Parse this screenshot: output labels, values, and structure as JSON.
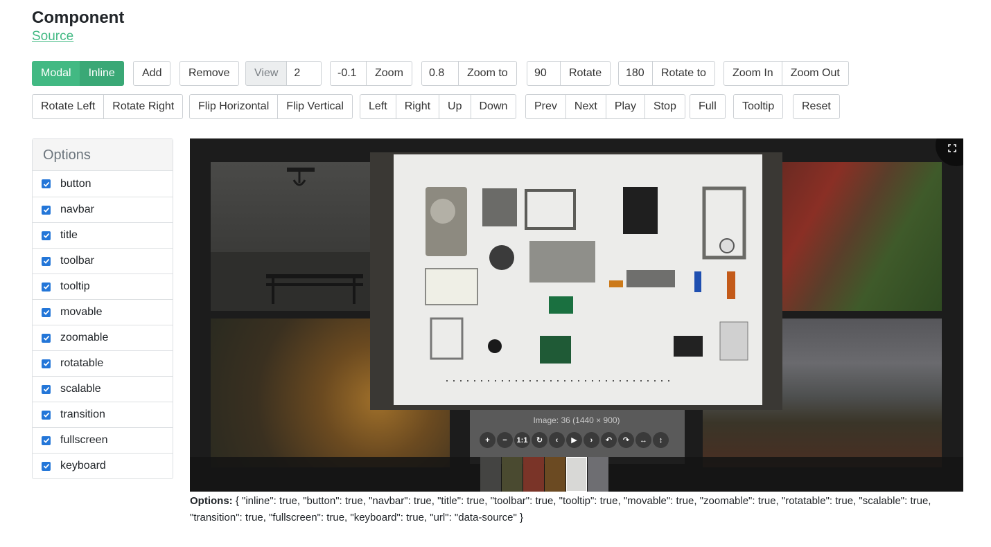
{
  "header": {
    "title": "Component",
    "source_link": "Source"
  },
  "toolbar_row1": {
    "modal": "Modal",
    "inline": "Inline",
    "add": "Add",
    "remove": "Remove",
    "view_label": "View",
    "view_value": "2",
    "zoom_value": "-0.1",
    "zoom": "Zoom",
    "zoom_to_value": "0.8",
    "zoom_to": "Zoom to",
    "rotate_value": "90",
    "rotate": "Rotate",
    "rotate_to_value": "180",
    "rotate_to": "Rotate to",
    "zoom_in": "Zoom In",
    "zoom_out": "Zoom Out"
  },
  "toolbar_row2": {
    "rotate_left": "Rotate Left",
    "rotate_right": "Rotate Right",
    "flip_horizontal": "Flip Horizontal",
    "flip_vertical": "Flip Vertical",
    "left": "Left",
    "right": "Right",
    "up": "Up",
    "down": "Down",
    "prev": "Prev",
    "next": "Next",
    "play": "Play",
    "stop": "Stop",
    "full": "Full",
    "tooltip": "Tooltip",
    "reset": "Reset"
  },
  "options_panel": {
    "heading": "Options",
    "items": [
      {
        "label": "button",
        "checked": true
      },
      {
        "label": "navbar",
        "checked": true
      },
      {
        "label": "title",
        "checked": true
      },
      {
        "label": "toolbar",
        "checked": true
      },
      {
        "label": "tooltip",
        "checked": true
      },
      {
        "label": "movable",
        "checked": true
      },
      {
        "label": "zoomable",
        "checked": true
      },
      {
        "label": "rotatable",
        "checked": true
      },
      {
        "label": "scalable",
        "checked": true
      },
      {
        "label": "transition",
        "checked": true
      },
      {
        "label": "fullscreen",
        "checked": true
      },
      {
        "label": "keyboard",
        "checked": true
      }
    ]
  },
  "viewer": {
    "image_title": "Image: 36 (1440 × 900)",
    "toolbar_icons": [
      "zoom-in-icon",
      "zoom-out-icon",
      "one-to-one-icon",
      "reset-icon",
      "prev-icon",
      "play-icon",
      "next-icon",
      "rotate-left-icon",
      "rotate-right-icon",
      "flip-horizontal-icon",
      "flip-vertical-icon"
    ],
    "toolbar_glyphs": [
      "+",
      "−",
      "1:1",
      "↻",
      "‹",
      "▶",
      "›",
      "↶",
      "↷",
      "↔",
      "↕"
    ],
    "fullscreen_icon": "fullscreen-icon"
  },
  "options_output": {
    "label": "Options:",
    "text": " { \"inline\": true, \"button\": true, \"navbar\": true, \"title\": true, \"toolbar\": true, \"tooltip\": true, \"movable\": true, \"zoomable\": true, \"rotatable\": true, \"scalable\": true, \"transition\": true, \"fullscreen\": true, \"keyboard\": true, \"url\": \"data-source\" }"
  },
  "colors": {
    "accent": "#42b983",
    "checkbox": "#2376d8"
  }
}
